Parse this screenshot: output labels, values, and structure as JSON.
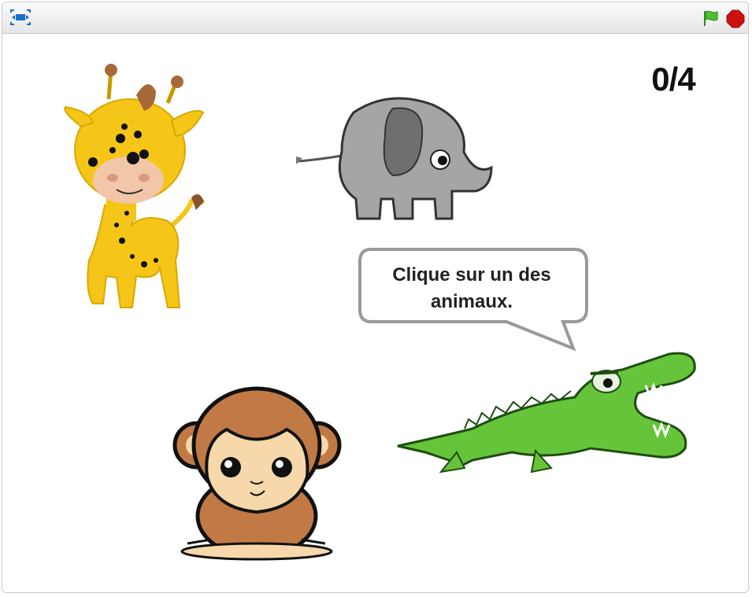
{
  "titlebar": {
    "fullscreen_icon": "fullscreen-toggle-icon",
    "green_flag_icon": "green-flag-icon",
    "stop_icon": "stop-sign-icon",
    "colors": {
      "flag": "#3fae2a",
      "stop": "#cc1111",
      "fullscreen": "#1a6fc9"
    }
  },
  "stage": {
    "score": "0/4",
    "speech": "Clique sur un des animaux.",
    "sprites": [
      "giraffe",
      "elephant",
      "monkey",
      "crocodile"
    ],
    "colors": {
      "giraffe": "#f5c518",
      "elephant": "#a3a6a2",
      "monkey": "#c17a45",
      "crocodile": "#66c43a"
    }
  }
}
